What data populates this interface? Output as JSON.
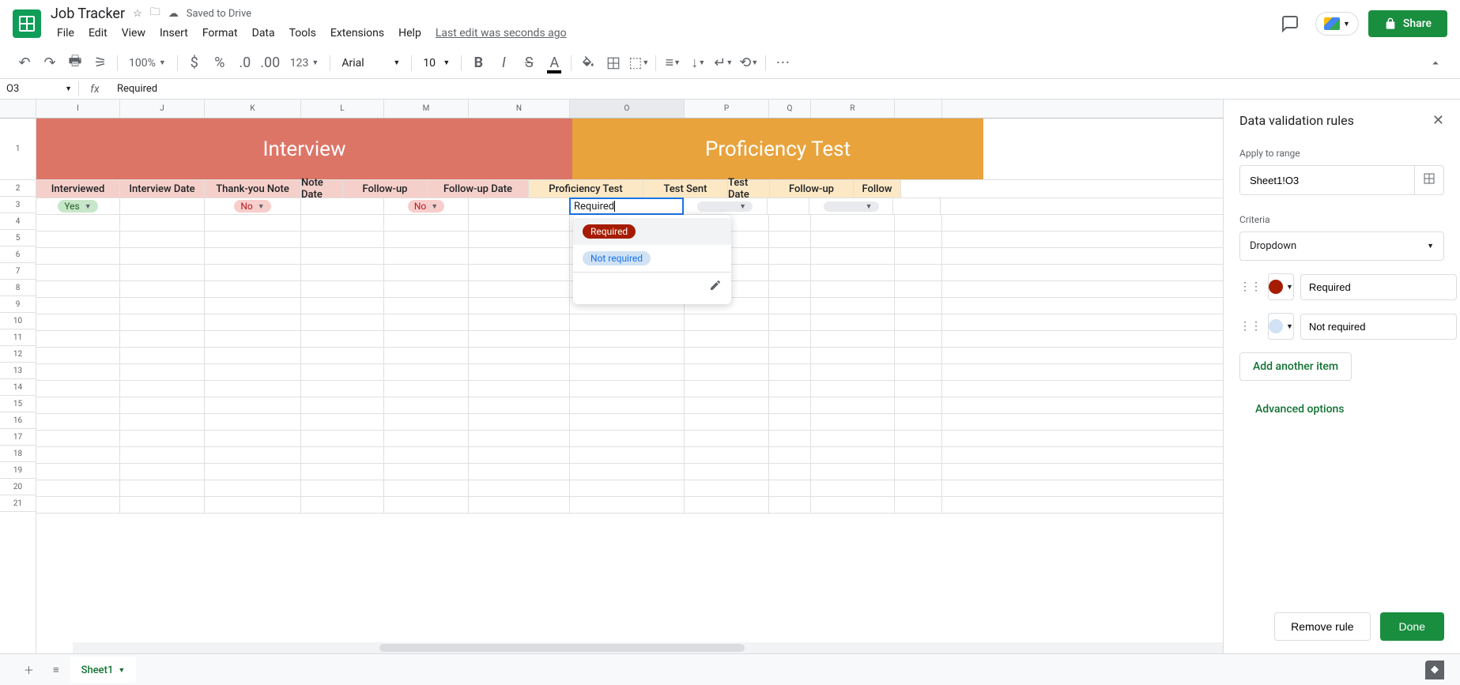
{
  "doc": {
    "title": "Job Tracker",
    "savedText": "Saved to Drive"
  },
  "menu": {
    "items": [
      "File",
      "Edit",
      "View",
      "Insert",
      "Format",
      "Data",
      "Tools",
      "Extensions",
      "Help"
    ],
    "lastEdit": "Last edit was seconds ago"
  },
  "share": {
    "label": "Share"
  },
  "toolbar": {
    "zoom": "100%",
    "font": "Arial",
    "size": "10",
    "numFmt": "123"
  },
  "nameBox": "O3",
  "formulaValue": "Required",
  "columns": [
    "I",
    "J",
    "K",
    "L",
    "M",
    "N",
    "O",
    "P",
    "Q",
    "R"
  ],
  "activeCol": "O",
  "mergedHeaders": {
    "interview": "Interview",
    "proficiency": "Proficiency Test"
  },
  "labelsInterview": [
    "Interviewed",
    "Interview Date",
    "Thank-you Note",
    "Note Date",
    "Follow-up",
    "Follow-up Date"
  ],
  "labelsProf": [
    "Proficiency Test",
    "Test Sent",
    "Test Date",
    "Follow-up",
    "Follow"
  ],
  "dataRow": {
    "interviewed": "Yes",
    "thankyou": "No",
    "followup": "No",
    "profTest": "Required"
  },
  "dropdown": {
    "opt1": "Required",
    "opt2": "Not required"
  },
  "sidebar": {
    "title": "Data validation rules",
    "applyLabel": "Apply to range",
    "range": "Sheet1!O3",
    "criteriaLabel": "Criteria",
    "criteriaValue": "Dropdown",
    "opt1": "Required",
    "opt2": "Not required",
    "addItem": "Add another item",
    "advanced": "Advanced options",
    "remove": "Remove rule",
    "done": "Done"
  },
  "sheetTab": "Sheet1"
}
